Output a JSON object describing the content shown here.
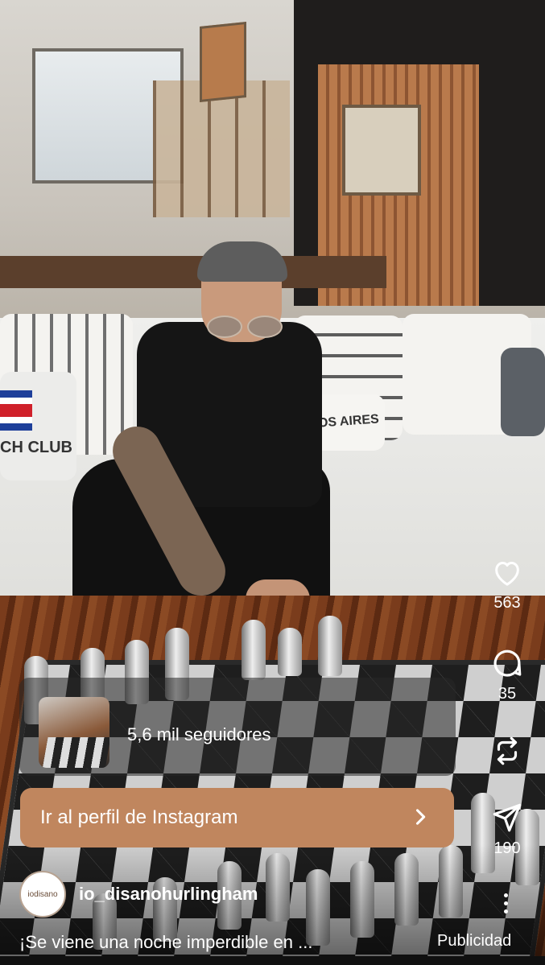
{
  "profile_card": {
    "followers": "5,6 mil seguidores",
    "cta_label": "Ir al perfil de Instagram",
    "cta_icon": "chevron-right-icon"
  },
  "actions": {
    "like_icon": "heart-icon",
    "like_count": "563",
    "comment_icon": "comment-bubble-icon",
    "comment_count": "35",
    "repost_icon": "repost-icon",
    "share_icon": "send-icon",
    "share_count": "190",
    "more_icon": "more-vertical-icon"
  },
  "post": {
    "avatar_text": "iodisano",
    "username": "io_disanohurlingham",
    "caption": "¡Se viene una noche imperdible en ...",
    "ad_label": "Publicidad"
  },
  "scene_text": {
    "pillow_left": "CH CLUB",
    "pillow_right": "OS AIRES"
  },
  "colors": {
    "cta_background": "#c0865e",
    "text": "#ffffff"
  }
}
